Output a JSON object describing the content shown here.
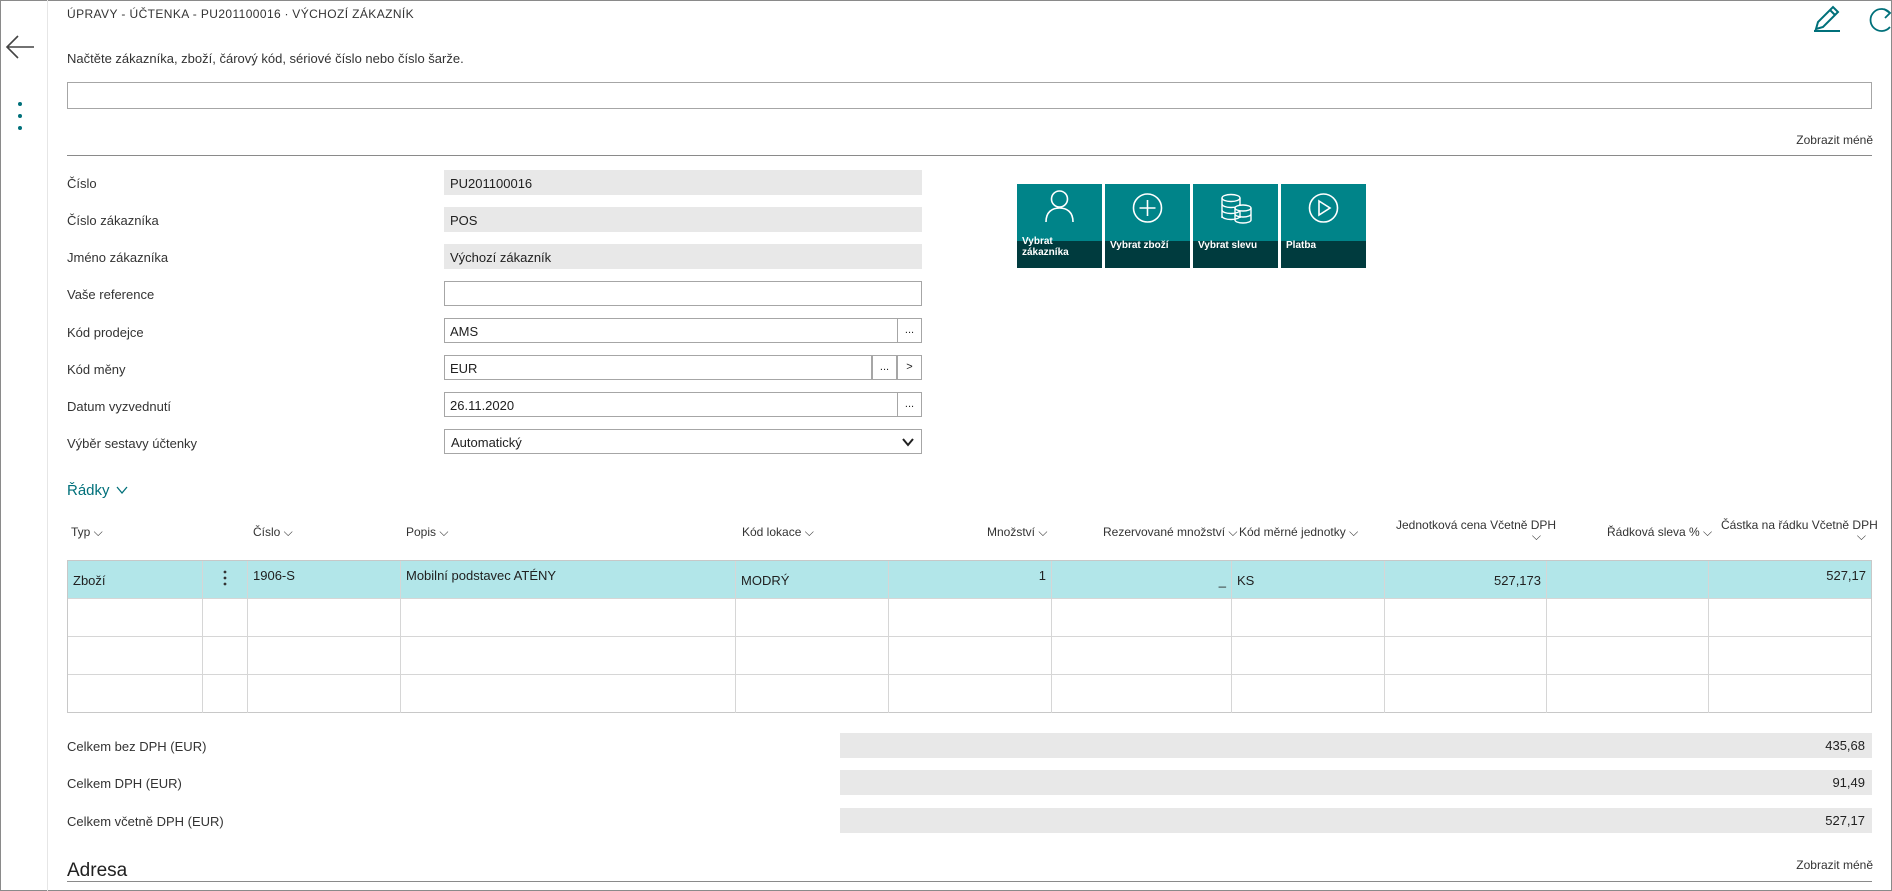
{
  "header": {
    "title": "ÚPRAVY - ÚČTENKA - PU201100016 ∙ VÝCHOZÍ ZÁKAZNÍK",
    "instruction": "Načtěte zákazníka, zboží, čárový kód, sériové číslo nebo číslo šarže.",
    "scan_value": "",
    "show_less": "Zobrazit méně"
  },
  "icons": {
    "back": "back-arrow-icon",
    "more": "more-vertical-icon",
    "edit": "edit-pencil-icon",
    "refresh": "refresh-icon"
  },
  "colors": {
    "accent": "#008489",
    "tile_dark": "#003b3e",
    "selected_row": "#b2e6e9",
    "readonly_bg": "#e8e8e8"
  },
  "fields": {
    "cislo": {
      "label": "Číslo",
      "value": "PU201100016"
    },
    "cislo_zakaznika": {
      "label": "Číslo zákazníka",
      "value": "POS"
    },
    "jmeno_zakaznika": {
      "label": "Jméno zákazníka",
      "value": "Výchozí zákazník"
    },
    "vase_reference": {
      "label": "Vaše reference",
      "value": ""
    },
    "kod_prodejce": {
      "label": "Kód prodejce",
      "value": "AMS",
      "lookup": "..."
    },
    "kod_meny": {
      "label": "Kód měny",
      "value": "EUR",
      "lookup": "...",
      "drilldown": ">"
    },
    "datum_vyzvednuti": {
      "label": "Datum vyzvednutí",
      "value": "26.11.2020",
      "lookup": "..."
    },
    "vyber_sestavy": {
      "label": "Výběr sestavy účtenky",
      "value": "Automatický"
    }
  },
  "tiles": [
    {
      "label": "Vybrat zákazníka",
      "icon": "person-icon"
    },
    {
      "label": "Vybrat zboží",
      "icon": "plus-circle-icon"
    },
    {
      "label": "Vybrat slevu",
      "icon": "coins-icon"
    },
    {
      "label": "Platba",
      "icon": "play-circle-icon"
    }
  ],
  "lines": {
    "section_title": "Řádky",
    "columns": {
      "typ": "Typ",
      "cislo": "Číslo",
      "popis": "Popis",
      "kod_lokace": "Kód lokace",
      "mnozstvi": "Množství",
      "rezervovane": "Rezervované množství",
      "kod_merne": "Kód měrné jednotky",
      "jedn_cena": "Jednotková cena Včetně DPH",
      "radkova_sleva": "Řádková sleva %",
      "castka": "Částka na řádku Včetně DPH"
    },
    "rows": [
      {
        "typ": "Zboží",
        "cislo": "1906-S",
        "popis": "Mobilní podstavec ATÉNY",
        "kod_lokace": "MODRÝ",
        "mnozstvi": "1",
        "rezervovane": "_",
        "kod_merne": "KS",
        "jedn_cena": "527,173",
        "radkova_sleva": "",
        "castka": "527,17"
      }
    ]
  },
  "totals": {
    "bez_dph": {
      "label": "Celkem bez DPH (EUR)",
      "value": "435,68"
    },
    "dph": {
      "label": "Celkem DPH (EUR)",
      "value": "91,49"
    },
    "vcetne_dph": {
      "label": "Celkem včetně DPH (EUR)",
      "value": "527,17"
    }
  },
  "address": {
    "title": "Adresa",
    "show_less": "Zobrazit méně"
  }
}
